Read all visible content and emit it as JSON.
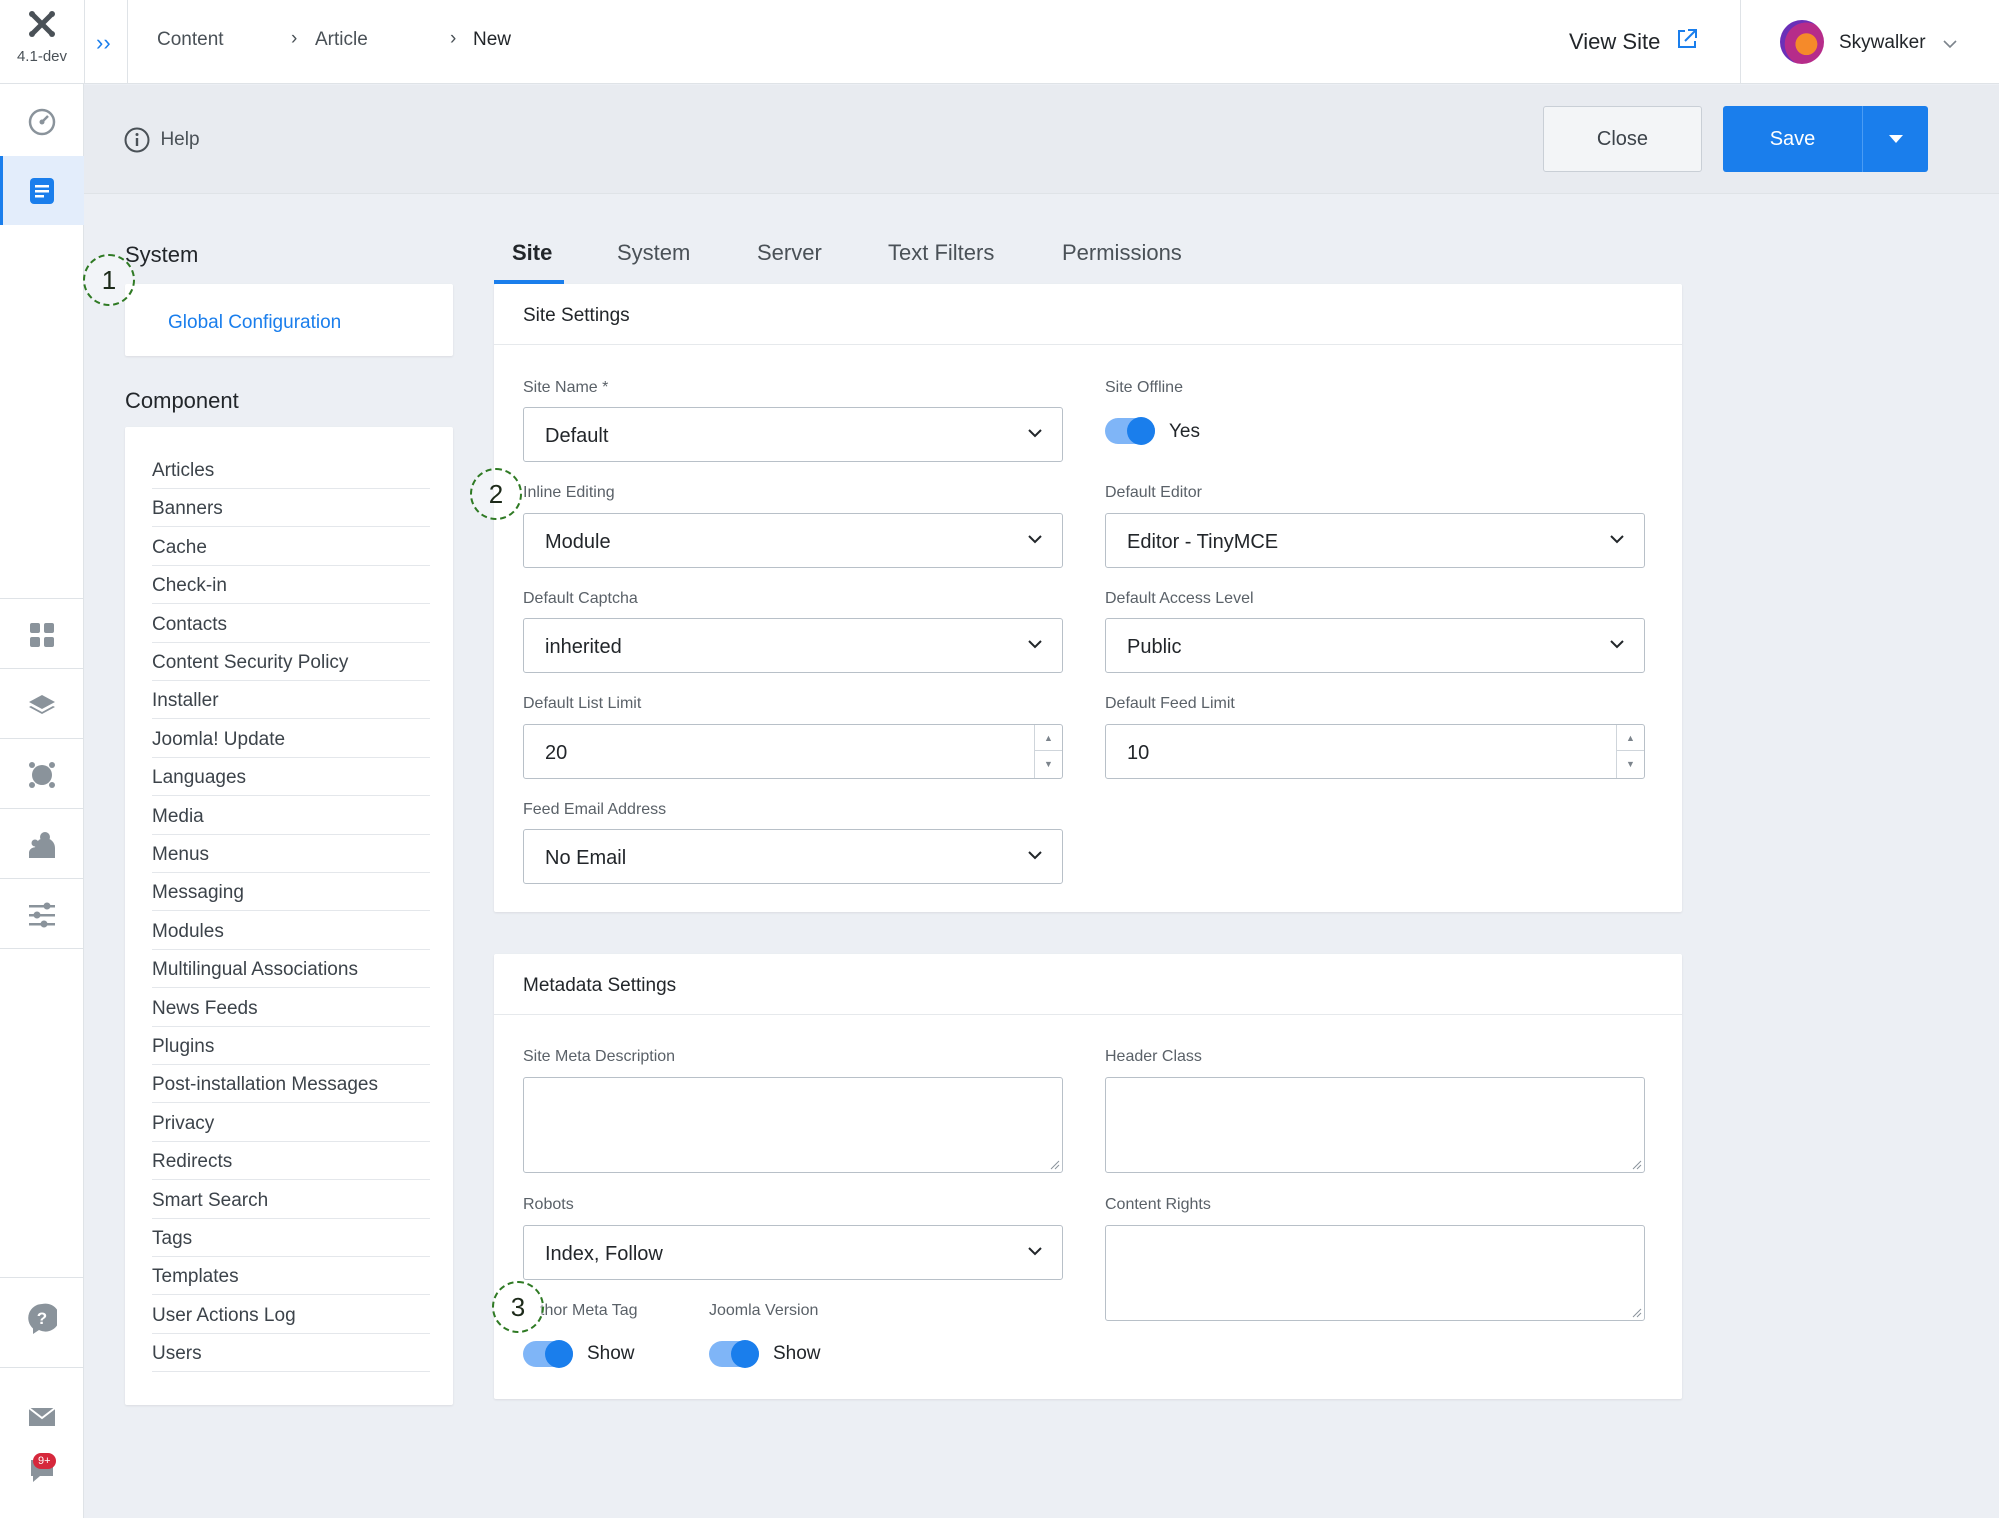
{
  "brand": {
    "version": "4.1-dev"
  },
  "breadcrumb": [
    "Content",
    "Article",
    "New"
  ],
  "header": {
    "view_site": "View Site",
    "user": "Skywalker"
  },
  "toolbar": {
    "help": "Help",
    "close": "Close",
    "save": "Save"
  },
  "sidebar": {
    "notification_badge": "9+"
  },
  "left": {
    "system_heading": "System",
    "global_config": "Global Configuration",
    "component_heading": "Component",
    "components": [
      "Articles",
      "Banners",
      "Cache",
      "Check-in",
      "Contacts",
      "Content Security Policy",
      "Installer",
      "Joomla! Update",
      "Languages",
      "Media",
      "Menus",
      "Messaging",
      "Modules",
      "Multilingual Associations",
      "News Feeds",
      "Plugins",
      "Post-installation Messages",
      "Privacy",
      "Redirects",
      "Smart Search",
      "Tags",
      "Templates",
      "User Actions Log",
      "Users"
    ]
  },
  "tabs": [
    "Site",
    "System",
    "Server",
    "Text Filters",
    "Permissions"
  ],
  "site_settings": {
    "title": "Site Settings",
    "site_name_label": "Site Name *",
    "site_name_value": "Default",
    "site_offline_label": "Site Offline",
    "site_offline_value": "Yes",
    "inline_editing_label": "Inline Editing",
    "inline_editing_value": "Module",
    "default_editor_label": "Default Editor",
    "default_editor_value": "Editor - TinyMCE",
    "default_captcha_label": "Default Captcha",
    "default_captcha_value": "inherited",
    "default_access_label": "Default Access Level",
    "default_access_value": "Public",
    "list_limit_label": "Default List Limit",
    "list_limit_value": "20",
    "feed_limit_label": "Default Feed Limit",
    "feed_limit_value": "10",
    "feed_email_label": "Feed Email Address",
    "feed_email_value": "No Email"
  },
  "metadata": {
    "title": "Metadata Settings",
    "meta_desc_label": "Site Meta Description",
    "header_class_label": "Header Class",
    "robots_label": "Robots",
    "robots_value": "Index, Follow",
    "content_rights_label": "Content Rights",
    "author_meta_label": "thor Meta Tag",
    "author_meta_value": "Show",
    "joomla_version_label": "Joomla Version",
    "joomla_version_value": "Show"
  },
  "markers": [
    "1",
    "2",
    "3"
  ],
  "colors": {
    "accent": "#1a7eec",
    "marker": "#2f7a24"
  }
}
